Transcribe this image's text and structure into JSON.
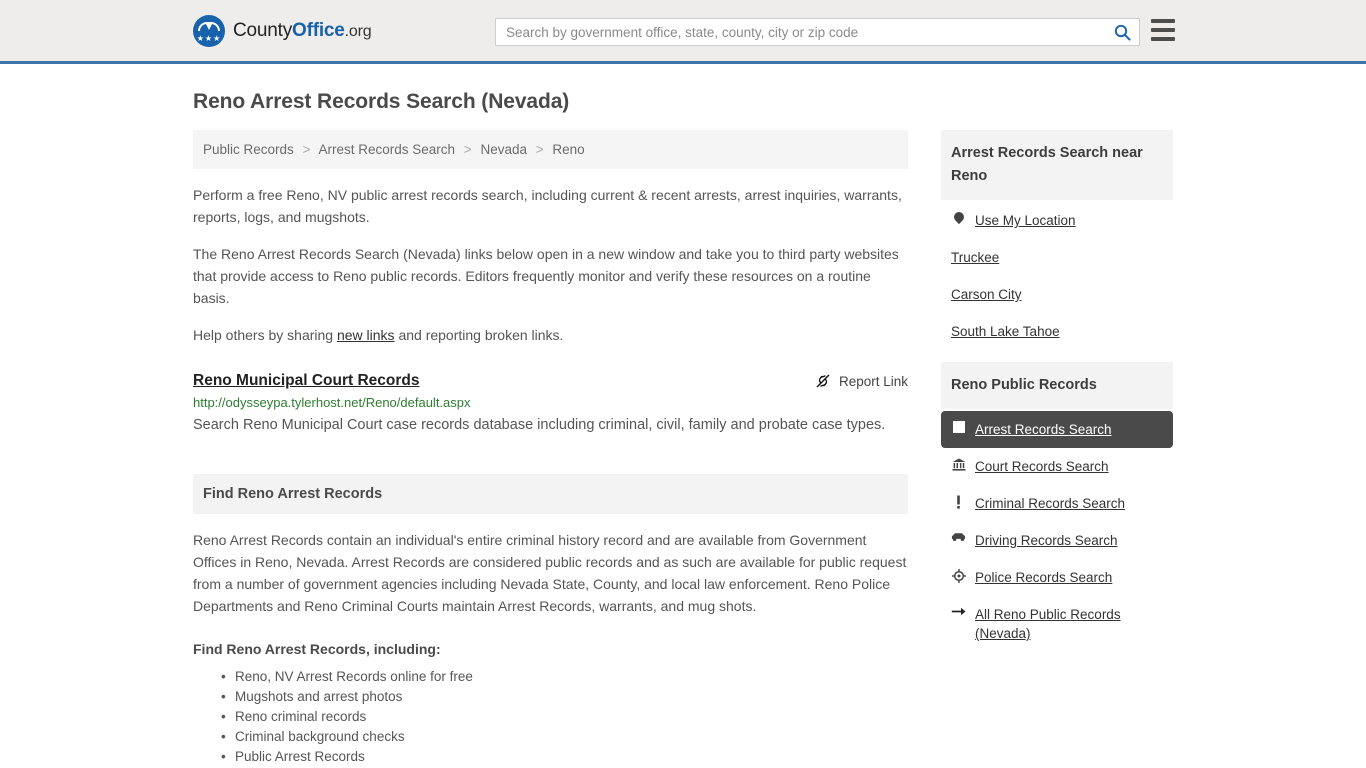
{
  "header": {
    "logo": {
      "text_county": "County",
      "text_office": "Office",
      "text_org": ".org",
      "stars": "★★★"
    },
    "search": {
      "placeholder": "Search by government office, state, county, city or zip code",
      "value": ""
    }
  },
  "page": {
    "title": "Reno Arrest Records Search (Nevada)"
  },
  "breadcrumb": {
    "items": [
      {
        "label": "Public Records"
      },
      {
        "label": "Arrest Records Search"
      },
      {
        "label": "Nevada"
      },
      {
        "label": "Reno"
      }
    ],
    "separator": ">"
  },
  "intro": {
    "p1": "Perform a free Reno, NV public arrest records search, including current & recent arrests, arrest inquiries, warrants, reports, logs, and mugshots.",
    "p2": "The Reno Arrest Records Search (Nevada) links below open in a new window and take you to third party websites that provide access to Reno public records. Editors frequently monitor and verify these resources on a routine basis.",
    "p3_before": "Help others by sharing ",
    "p3_link": "new links",
    "p3_after": " and reporting broken links."
  },
  "result": {
    "title": "Reno Municipal Court Records",
    "url": "http://odysseypa.tylerhost.net/Reno/default.aspx",
    "description": "Search Reno Municipal Court case records database including criminal, civil, family and probate case types.",
    "report_label": "Report Link"
  },
  "find_section": {
    "heading": "Find Reno Arrest Records",
    "body": "Reno Arrest Records contain an individual's entire criminal history record and are available from Government Offices in Reno, Nevada. Arrest Records are considered public records and as such are available for public request from a number of government agencies including Nevada State, County, and local law enforcement. Reno Police Departments and Reno Criminal Courts maintain Arrest Records, warrants, and mug shots.",
    "sub_heading": "Find Reno Arrest Records, including:",
    "bullets": [
      "Reno, NV Arrest Records online for free",
      "Mugshots and arrest photos",
      "Reno criminal records",
      "Criminal background checks",
      "Public Arrest Records"
    ]
  },
  "sidebar": {
    "near": {
      "heading": "Arrest Records Search near Reno",
      "items": [
        {
          "label": "Use My Location",
          "icon": "map-pin-icon"
        },
        {
          "label": "Truckee",
          "icon": "none"
        },
        {
          "label": "Carson City",
          "icon": "none"
        },
        {
          "label": "South Lake Tahoe",
          "icon": "none"
        }
      ]
    },
    "records": {
      "heading": "Reno Public Records",
      "items": [
        {
          "label": "Arrest Records Search",
          "icon": "square-icon",
          "active": true
        },
        {
          "label": "Court Records Search",
          "icon": "courthouse-icon",
          "active": false
        },
        {
          "label": "Criminal Records Search",
          "icon": "exclamation-icon",
          "active": false
        },
        {
          "label": "Driving Records Search",
          "icon": "car-icon",
          "active": false
        },
        {
          "label": "Police Records Search",
          "icon": "badge-icon",
          "active": false
        },
        {
          "label": "All Reno Public Records (Nevada)",
          "icon": "arrow-right-icon",
          "active": false
        }
      ]
    }
  },
  "colors": {
    "header_bg": "#eeedeb",
    "header_border": "#3b73a8",
    "brand_blue": "#1862ab",
    "active_bg": "#4a4a4a",
    "url_green": "#2e7d32",
    "panel_gray": "#f3f3f3"
  }
}
